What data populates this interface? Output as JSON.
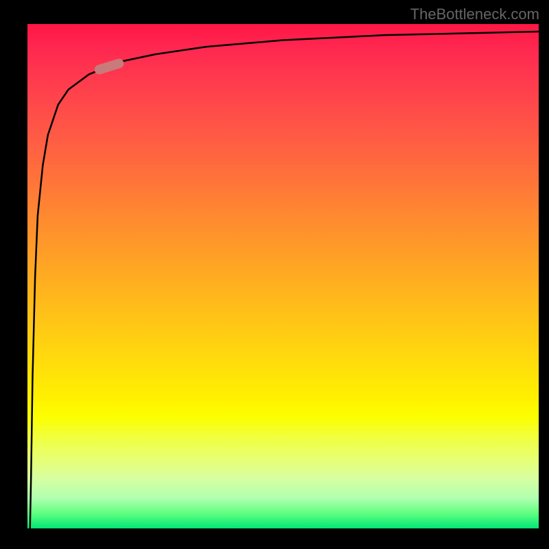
{
  "watermark": "TheBottleneck.com",
  "chart_data": {
    "type": "line",
    "title": "",
    "xlabel": "",
    "ylabel": "",
    "x_range": [
      0,
      100
    ],
    "y_range": [
      0,
      100
    ],
    "curve_points": [
      {
        "x": 0.5,
        "y": 0
      },
      {
        "x": 0.7,
        "y": 10
      },
      {
        "x": 1.0,
        "y": 30
      },
      {
        "x": 1.5,
        "y": 50
      },
      {
        "x": 2.0,
        "y": 62
      },
      {
        "x": 3.0,
        "y": 72
      },
      {
        "x": 4.0,
        "y": 78
      },
      {
        "x": 6.0,
        "y": 84
      },
      {
        "x": 8.0,
        "y": 87
      },
      {
        "x": 12.0,
        "y": 90
      },
      {
        "x": 18.0,
        "y": 92.5
      },
      {
        "x": 25.0,
        "y": 94
      },
      {
        "x": 35.0,
        "y": 95.5
      },
      {
        "x": 50.0,
        "y": 96.8
      },
      {
        "x": 70.0,
        "y": 97.8
      },
      {
        "x": 100.0,
        "y": 98.5
      }
    ],
    "marker": {
      "x": 16,
      "y": 91.5,
      "color": "#c97a7a"
    },
    "gradient_colors": {
      "top": "#ff1744",
      "middle_top": "#ff6b3d",
      "middle": "#ffc815",
      "middle_bottom": "#fff000",
      "bottom": "#00e676"
    }
  }
}
